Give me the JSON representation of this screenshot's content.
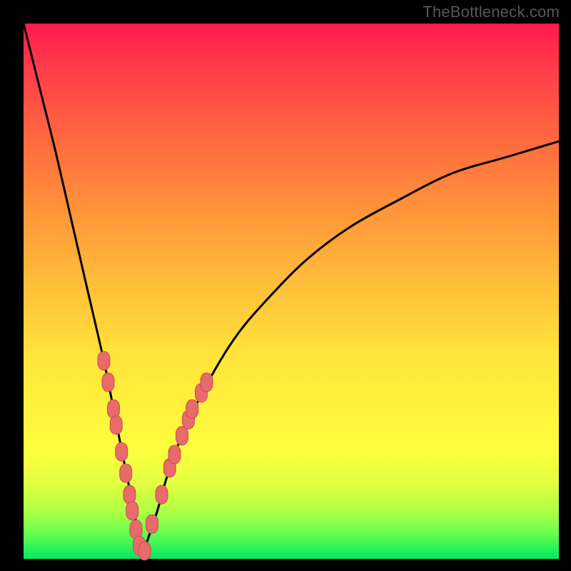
{
  "watermark": "TheBottleneck.com",
  "colors": {
    "frame": "#000000",
    "curve": "#000000",
    "marker_fill": "#e86a6a",
    "marker_stroke": "#c94f4f"
  },
  "chart_data": {
    "type": "line",
    "title": "",
    "xlabel": "",
    "ylabel": "",
    "xlim": [
      0,
      100
    ],
    "ylim": [
      0,
      100
    ],
    "background_gradient": [
      "#ff1a4d",
      "#ff983a",
      "#fff23c",
      "#00e860"
    ],
    "curve_description": "Asymmetric V-shaped bottleneck curve; minimum near x≈22, y≈0; left branch steep toward y≈100 at x=0, right branch rises more slowly toward y≈78 at x=100.",
    "series": [
      {
        "name": "bottleneck-curve",
        "x": [
          0,
          3,
          6,
          9,
          12,
          15,
          17,
          19,
          21,
          22,
          23,
          25,
          27,
          30,
          35,
          40,
          46,
          53,
          61,
          70,
          80,
          90,
          100
        ],
        "y": [
          100,
          88,
          76,
          63,
          50,
          37,
          27,
          17,
          7,
          0,
          3,
          9,
          16,
          24,
          34,
          42,
          49,
          56,
          62,
          67,
          72,
          75,
          78
        ]
      }
    ],
    "markers": {
      "name": "sample-points",
      "shape": "rounded-rect",
      "color": "#e86a6a",
      "points": [
        {
          "x": 15.0,
          "y": 37
        },
        {
          "x": 15.8,
          "y": 33
        },
        {
          "x": 16.8,
          "y": 28
        },
        {
          "x": 17.3,
          "y": 25
        },
        {
          "x": 18.3,
          "y": 20
        },
        {
          "x": 19.1,
          "y": 16
        },
        {
          "x": 19.8,
          "y": 12
        },
        {
          "x": 20.3,
          "y": 9
        },
        {
          "x": 21.0,
          "y": 5.5
        },
        {
          "x": 21.6,
          "y": 2.5
        },
        {
          "x": 22.6,
          "y": 1.5
        },
        {
          "x": 24.0,
          "y": 6.5
        },
        {
          "x": 25.8,
          "y": 12
        },
        {
          "x": 27.3,
          "y": 17
        },
        {
          "x": 28.2,
          "y": 19.5
        },
        {
          "x": 29.6,
          "y": 23
        },
        {
          "x": 30.8,
          "y": 26
        },
        {
          "x": 31.5,
          "y": 28
        },
        {
          "x": 33.2,
          "y": 31
        },
        {
          "x": 34.2,
          "y": 33
        }
      ]
    }
  }
}
